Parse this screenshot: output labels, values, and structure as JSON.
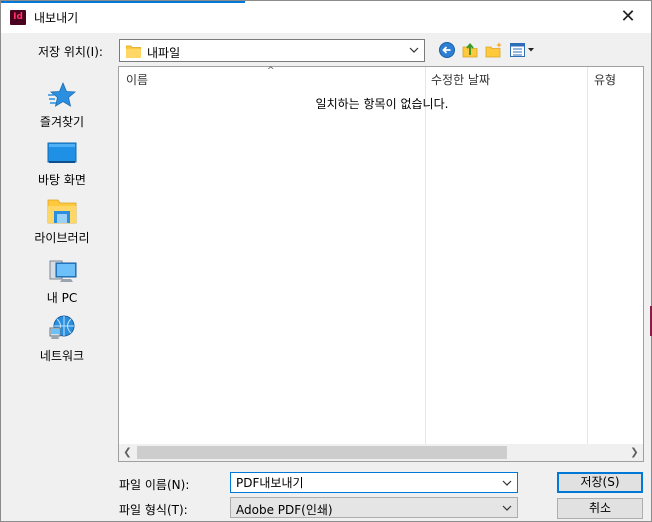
{
  "window": {
    "app_icon_text": "Id",
    "title": "내보내기",
    "close_glyph": "✕"
  },
  "location": {
    "label": "저장 위치(I):",
    "current_folder": "내파일"
  },
  "places": [
    {
      "label": "즐겨찾기",
      "icon": "star-icon"
    },
    {
      "label": "바탕 화면",
      "icon": "desktop-icon"
    },
    {
      "label": "라이브러리",
      "icon": "library-folder-icon"
    },
    {
      "label": "내 PC",
      "icon": "computer-icon"
    },
    {
      "label": "네트워크",
      "icon": "network-icon"
    }
  ],
  "columns": {
    "name": "이름",
    "modified": "수정한 날짜",
    "type": "유형"
  },
  "empty_message": "일치하는 항목이 없습니다.",
  "filename": {
    "label": "파일 이름(N):",
    "value": "PDF내보내기"
  },
  "filetype": {
    "label": "파일 형식(T):",
    "value": "Adobe PDF(인쇄)"
  },
  "buttons": {
    "save": "저장(S)",
    "cancel": "취소"
  },
  "colors": {
    "accent": "#0078d7",
    "folder": "#ffc83d",
    "app_icon_bg": "#49021f",
    "app_icon_fg": "#ff3366"
  }
}
